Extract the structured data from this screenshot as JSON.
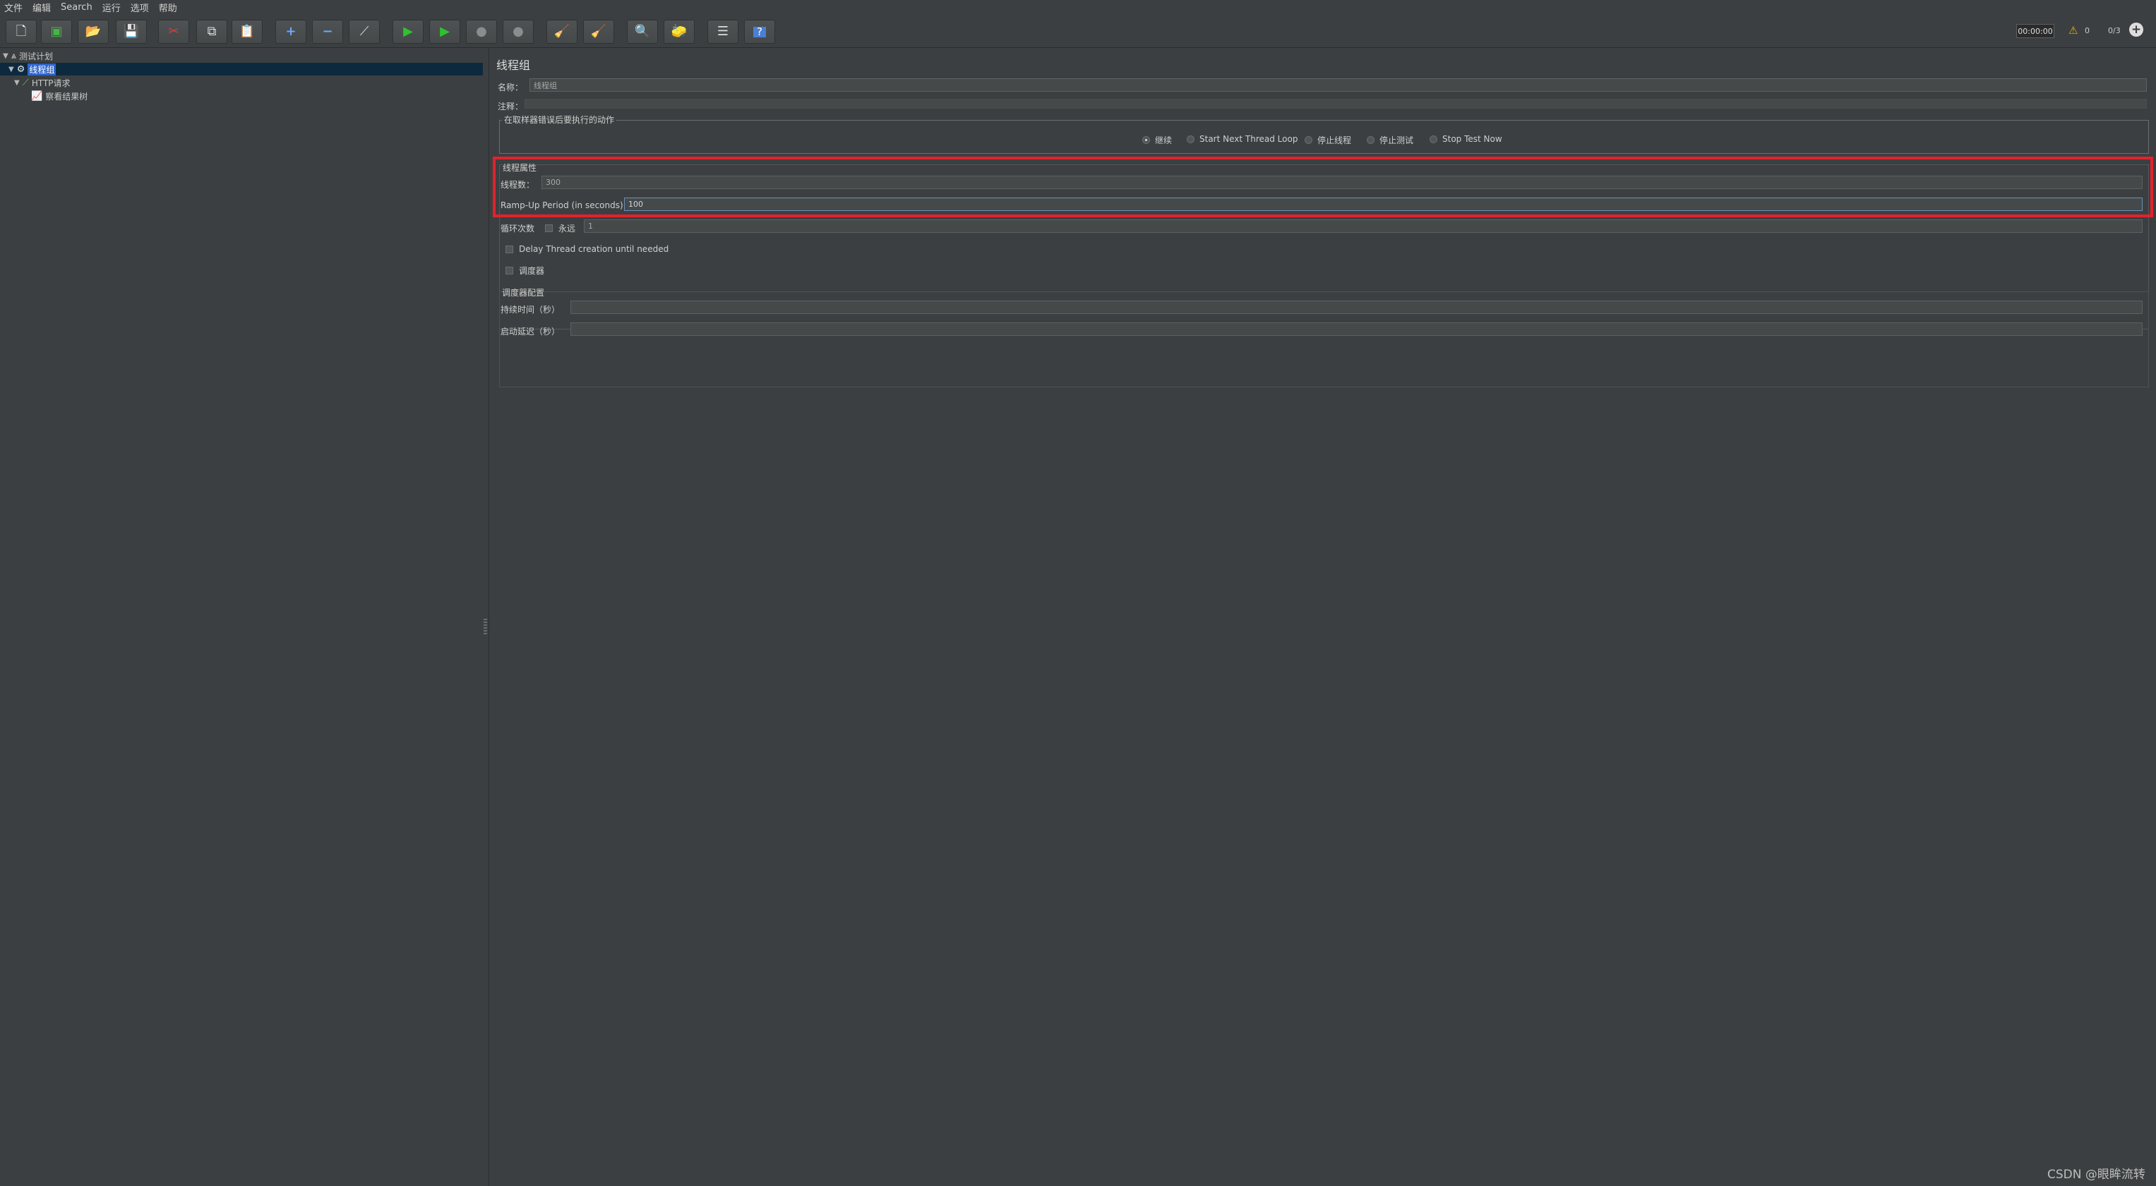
{
  "menu": [
    "文件",
    "编辑",
    "Search",
    "运行",
    "选项",
    "帮助"
  ],
  "toolbar": {
    "icons": [
      {
        "name": "new-icon",
        "glyph": "🗋"
      },
      {
        "name": "templates-icon",
        "glyph": "▣"
      },
      {
        "name": "open-icon",
        "glyph": "📂"
      },
      {
        "name": "save-icon",
        "glyph": "💾"
      },
      {
        "name": "cut-icon",
        "glyph": "✂"
      },
      {
        "name": "copy-icon",
        "glyph": "⧉"
      },
      {
        "name": "paste-icon",
        "glyph": "📋"
      },
      {
        "name": "expand-icon",
        "glyph": "+"
      },
      {
        "name": "collapse-icon",
        "glyph": "−"
      },
      {
        "name": "toggle-icon",
        "glyph": "⟋"
      },
      {
        "name": "start-icon",
        "glyph": "▶"
      },
      {
        "name": "start-no-pause-icon",
        "glyph": "▶"
      },
      {
        "name": "stop-icon",
        "glyph": "●"
      },
      {
        "name": "shutdown-icon",
        "glyph": "●"
      },
      {
        "name": "clear-icon",
        "glyph": "🧹"
      },
      {
        "name": "clear-all-icon",
        "glyph": "🧹"
      },
      {
        "name": "search-icon",
        "glyph": "🔍"
      },
      {
        "name": "reset-search-icon",
        "glyph": "🧽"
      },
      {
        "name": "function-helper-icon",
        "glyph": "☰"
      },
      {
        "name": "help-icon",
        "glyph": "?"
      }
    ],
    "colors": {
      "start": "#2ec22e",
      "cut": "#e03b3b",
      "help_bg": "#4a7fd4",
      "expand": "#6ea8ff"
    }
  },
  "status": {
    "timer": "00:00:00",
    "warnings": "0",
    "threads": "0/3"
  },
  "tree": {
    "plan": "测试计划",
    "thread_group": "线程组",
    "http_request": "HTTP请求",
    "result_tree": "察看结果树"
  },
  "panel": {
    "title": "线程组",
    "name_label": "名称：",
    "name_value": "线程组",
    "comment_label": "注释：",
    "sampler_error_legend": "在取样器错误后要执行的动作",
    "actions": [
      {
        "label": "继续",
        "selected": true
      },
      {
        "label": "Start Next Thread Loop",
        "selected": false
      },
      {
        "label": "停止线程",
        "selected": false
      },
      {
        "label": "停止测试",
        "selected": false
      },
      {
        "label": "Stop Test Now",
        "selected": false
      }
    ],
    "thread_props_title": "线程属性",
    "threads_label": "线程数：",
    "threads_value": "300",
    "rampup_label": "Ramp-Up Period (in seconds):",
    "rampup_value": "100",
    "loop_label": "循环次数",
    "forever_label": "永远",
    "loop_value": "1",
    "delay_label": "Delay Thread creation until needed",
    "scheduler_label": "调度器",
    "scheduler_config_title": "调度器配置",
    "duration_label": "持续时间（秒）",
    "startup_delay_label": "启动延迟（秒）"
  },
  "highlight_color": "#e1222b",
  "watermark": "CSDN @眼眸流转"
}
